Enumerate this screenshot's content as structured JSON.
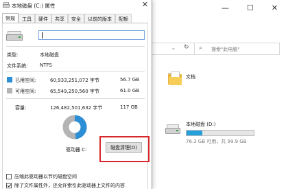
{
  "dialog": {
    "title": "本地磁盘 (C:) 属性",
    "close_glyph": "✕",
    "tabs": [
      {
        "label": "常规",
        "active": true
      },
      {
        "label": "工具",
        "active": false
      },
      {
        "label": "硬件",
        "active": false
      },
      {
        "label": "共享",
        "active": false
      },
      {
        "label": "安全",
        "active": false
      },
      {
        "label": "以前的版本",
        "active": false
      },
      {
        "label": "配额",
        "active": false
      }
    ],
    "drive_name_value": "",
    "type_label": "类型:",
    "type_value": "本地磁盘",
    "fs_label": "文件系统:",
    "fs_value": "NTFS",
    "used_label": "已用空间:",
    "used_bytes": "60,933,251,072 字节",
    "used_size": "56.7 GB",
    "free_label": "可用空间:",
    "free_bytes": "65,549,250,560 字节",
    "free_size": "61.0 GB",
    "capacity_label": "容量:",
    "capacity_bytes": "126,482,501,632 字节",
    "capacity_size": "117 GB",
    "used_fraction": 0.482,
    "drive_label": "驱动器 C:",
    "cleanup_button": "磁盘清理(D)",
    "checkboxes": [
      {
        "label": "压缩此驱动器以节约磁盘空间",
        "checked": false
      },
      {
        "label": "除了文件属性外，还允许索引此驱动器上文件的内容",
        "checked": true
      }
    ],
    "colors": {
      "used": "#2c8fd6",
      "free": "#b4b4b4",
      "highlight": "#d8262b"
    }
  },
  "explorer": {
    "window_buttons": [
      "—",
      "☐",
      "✕"
    ],
    "dropdown_glyph": "⌄",
    "refresh_glyph": "↻",
    "search_icon": "⌕",
    "search_placeholder": "搜索\"此电脑\"",
    "folder_label": "文档",
    "drive_d_name": "本地磁盘 (D:)",
    "drive_d_free": "76.3 GB 可用，共 99.9 GB",
    "drive_d_used_fraction": 0.236,
    "colors": {
      "drive_bar": "#26a0da",
      "folder": "#e8b53c"
    }
  }
}
